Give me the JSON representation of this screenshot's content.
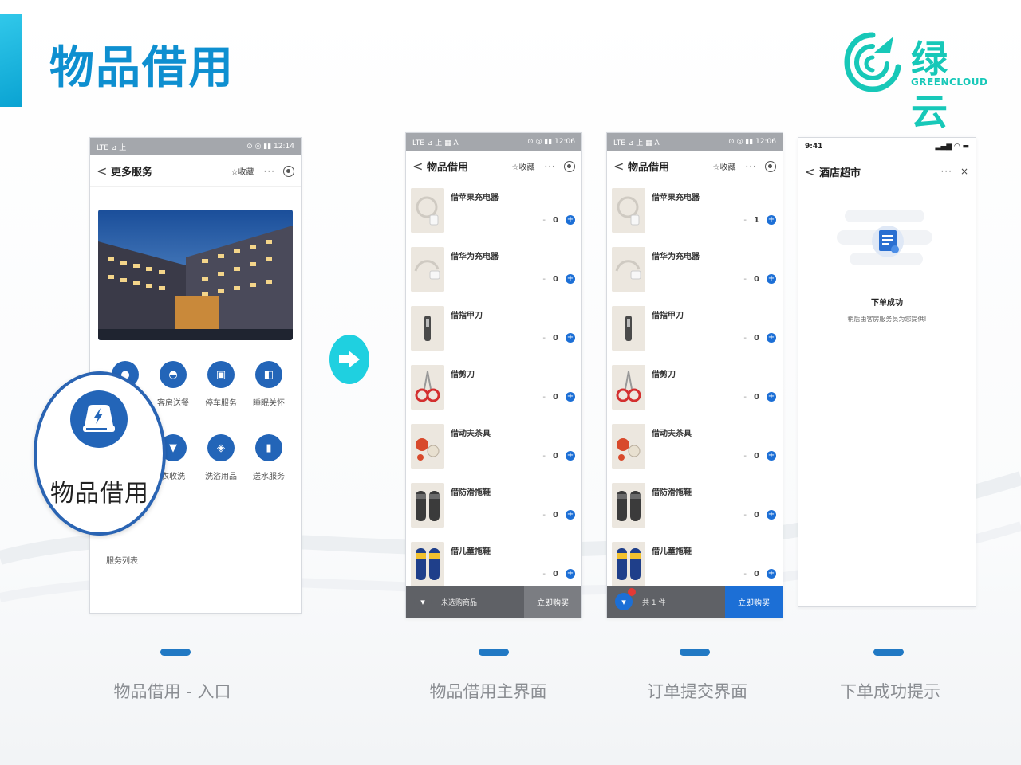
{
  "slide": {
    "title": "物品借用",
    "logo": {
      "cn": "绿云",
      "en": "GREENCLOUD",
      "color": "#17c8b8"
    },
    "accent_color": "#0e8fd0"
  },
  "phone1": {
    "status_left": "LTE ⊿ 上",
    "status_right": "⊙ ◎ ▮▮ 12:14",
    "nav": {
      "back": "<",
      "title": "更多服务",
      "fav": "☆收藏",
      "more": "···"
    },
    "services": [
      {
        "label": "",
        "icon": "bell-icon"
      },
      {
        "label": "客房送餐",
        "icon": "dome-icon"
      },
      {
        "label": "停车服务",
        "icon": "car-icon"
      },
      {
        "label": "睡眠关怀",
        "icon": "moon-icon"
      },
      {
        "label": "",
        "icon": "shirt-icon"
      },
      {
        "label": "衣收洗",
        "icon": "shirt-icon"
      },
      {
        "label": "洗浴用品",
        "icon": "bottle-icon"
      },
      {
        "label": "送水服务",
        "icon": "water-icon"
      }
    ],
    "service_list_label": "服务列表",
    "zoom_label": "物品借用"
  },
  "phone2": {
    "status_left": "LTE ⊿ 上 ▦ A",
    "status_right": "⊙ ◎ ▮▮ 12:06",
    "nav": {
      "back": "<",
      "title": "物品借用",
      "fav": "☆收藏",
      "more": "···"
    },
    "items": [
      {
        "name": "借苹果充电器",
        "qty": "0"
      },
      {
        "name": "借华为充电器",
        "qty": "0"
      },
      {
        "name": "借指甲刀",
        "qty": "0"
      },
      {
        "name": "借剪刀",
        "qty": "0"
      },
      {
        "name": "借动夫茶具",
        "qty": "0"
      },
      {
        "name": "借防滑拖鞋",
        "qty": "0"
      },
      {
        "name": "借儿童拖鞋",
        "qty": "0"
      }
    ],
    "cart_text": "未选购商品",
    "cart_button": "立即购买"
  },
  "phone3": {
    "status_left": "LTE ⊿ 上 ▦ A",
    "status_right": "⊙ ◎ ▮▮ 12:06",
    "nav": {
      "back": "<",
      "title": "物品借用",
      "fav": "☆收藏",
      "more": "···"
    },
    "items": [
      {
        "name": "借苹果充电器",
        "qty": "1"
      },
      {
        "name": "借华为充电器",
        "qty": "0"
      },
      {
        "name": "借指甲刀",
        "qty": "0"
      },
      {
        "name": "借剪刀",
        "qty": "0"
      },
      {
        "name": "借动夫茶具",
        "qty": "0"
      },
      {
        "name": "借防滑拖鞋",
        "qty": "0"
      },
      {
        "name": "借儿童拖鞋",
        "qty": "0"
      }
    ],
    "cart_text": "共 1 件",
    "cart_button": "立即购买"
  },
  "phone4": {
    "status_left": "9:41",
    "status_right": "▂▄▆ ◠ ▬",
    "nav": {
      "back": "<",
      "title": "酒店超市",
      "more": "···",
      "close": "×"
    },
    "success_title": "下单成功",
    "success_sub": "稍后由客房服务员为您提供!"
  },
  "captions": [
    "物品借用 - 入口",
    "物品借用主界面",
    "订单提交界面",
    "下单成功提示"
  ]
}
